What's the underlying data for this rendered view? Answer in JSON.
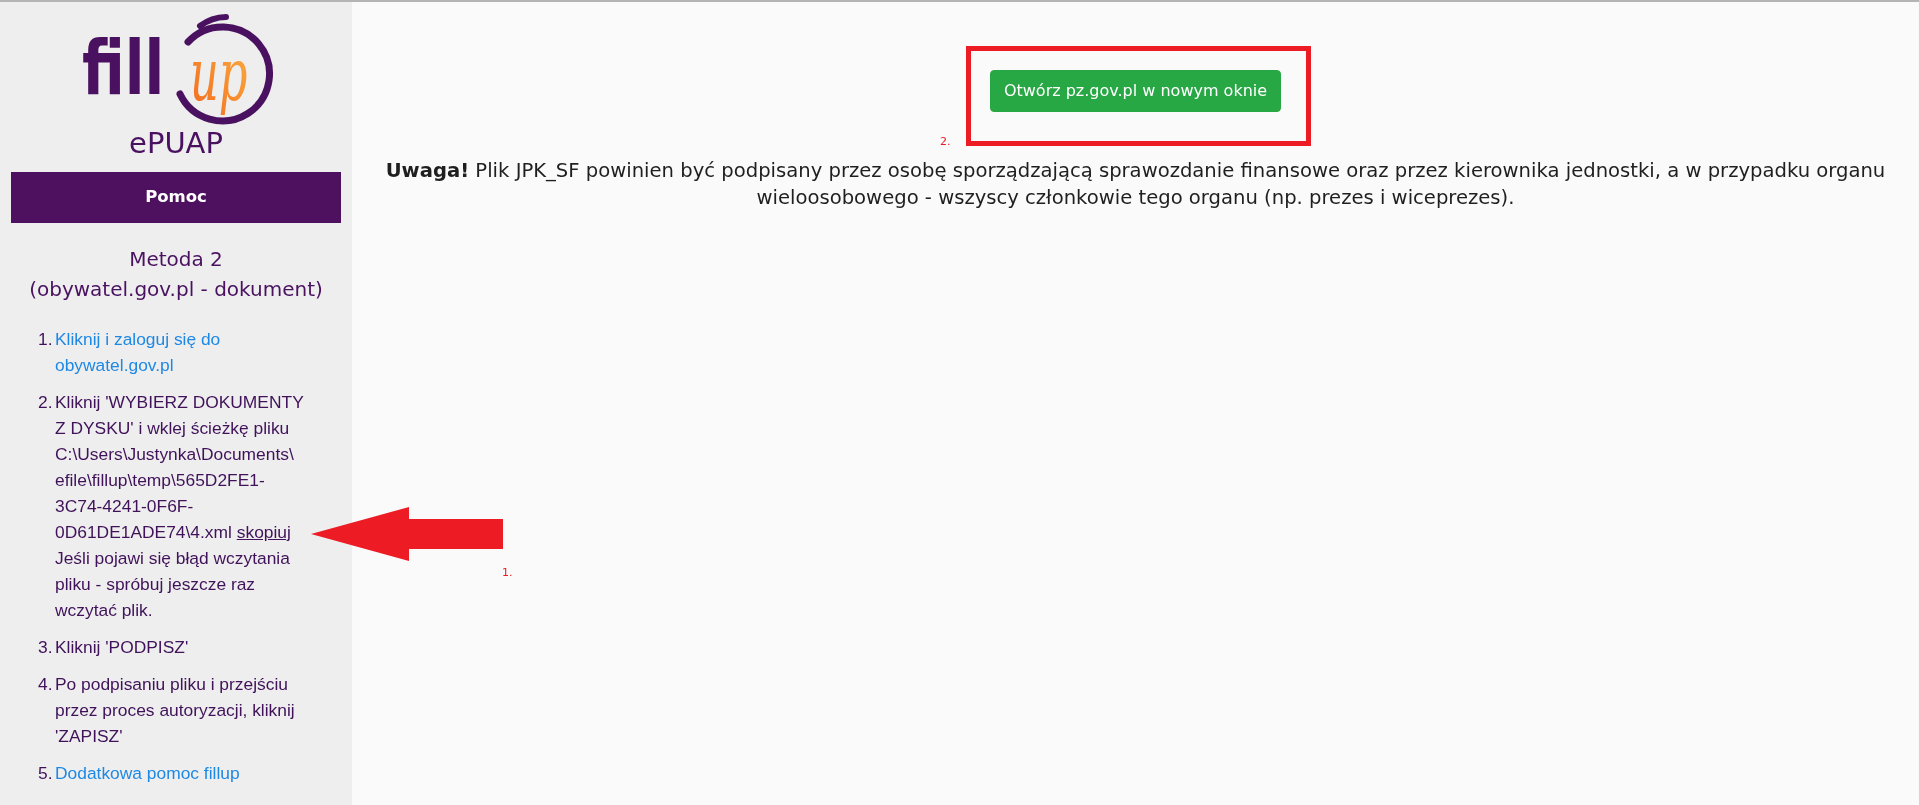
{
  "sidebar": {
    "logo": {
      "text": "fill",
      "script_text": "up"
    },
    "product": "ePUAP",
    "help_bar": "Pomoc",
    "method_title": "Metoda 2",
    "method_subtitle": "(obywatel.gov.pl - dokument)",
    "steps": [
      {
        "number": "1.",
        "segments": [
          {
            "kind": "link",
            "text": "Kliknij i zaloguj się do obywatel.gov.pl"
          }
        ]
      },
      {
        "number": "2.",
        "segments": [
          {
            "kind": "text",
            "text": "Kliknij 'WYBIERZ DOKUMENTY Z DYSKU' i wklej ścieżkę pliku C:\\Users\\Justynka\\Documents\\efile\\fillup\\temp\\565D2FE1-3C74-4241-0F6F-0D61DE1ADE74\\4.xml"
          },
          {
            "kind": "copy",
            "text": "skopiuj"
          },
          {
            "kind": "text",
            "text": "Jeśli pojawi się błąd wczytania pliku - spróbuj jeszcze raz wczytać plik."
          }
        ]
      },
      {
        "number": "3.",
        "segments": [
          {
            "kind": "text",
            "text": "Kliknij 'PODPISZ'"
          }
        ]
      },
      {
        "number": "4.",
        "segments": [
          {
            "kind": "text",
            "text": "Po podpisaniu pliku i przejściu przez proces autoryzacji, kliknij 'ZAPISZ'"
          }
        ]
      },
      {
        "number": "5.",
        "segments": [
          {
            "kind": "link",
            "text": "Dodatkowa pomoc fillup"
          }
        ]
      }
    ]
  },
  "main": {
    "open_button": "Otwórz pz.gov.pl w nowym oknie",
    "notice": "**Uwaga!** Plik JPK_SF powinien być podpisany przez osobę sporządzającą sprawozdanie finansowe oraz przez kierownika jednostki, a w przypadku organu wieloosobowego - wszyscy członkowie tego organu (np. prezes i wiceprezes)."
  },
  "annotations": [
    {
      "kind": "arrow",
      "label": "1."
    },
    {
      "kind": "frame",
      "label": "2."
    }
  ]
}
